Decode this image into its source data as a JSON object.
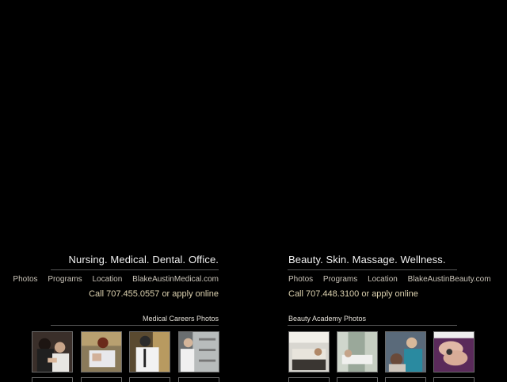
{
  "medical": {
    "tagline": "Nursing. Medical. Dental. Office.",
    "nav": [
      "Photos",
      "Programs",
      "Location",
      "BlakeAustinMedical.com"
    ],
    "call": "Call 707.455.0557 or apply online",
    "gallery_title": "Medical Careers Photos",
    "thumbs": [
      "medical-photo-1",
      "medical-photo-2",
      "medical-photo-3",
      "medical-photo-4"
    ]
  },
  "beauty": {
    "tagline": "Beauty. Skin. Massage. Wellness.",
    "nav": [
      "Photos",
      "Programs",
      "Location",
      "BlakeAustinBeauty.com"
    ],
    "call": "Call 707.448.3100 or apply online",
    "gallery_title": "Beauty Academy Photos",
    "thumbs": [
      "beauty-photo-1",
      "beauty-photo-2",
      "beauty-photo-3",
      "beauty-photo-4"
    ]
  },
  "colors": {
    "background": "#000000",
    "nav_text": "#c9c3b8",
    "call_text": "#ddd2b0"
  }
}
